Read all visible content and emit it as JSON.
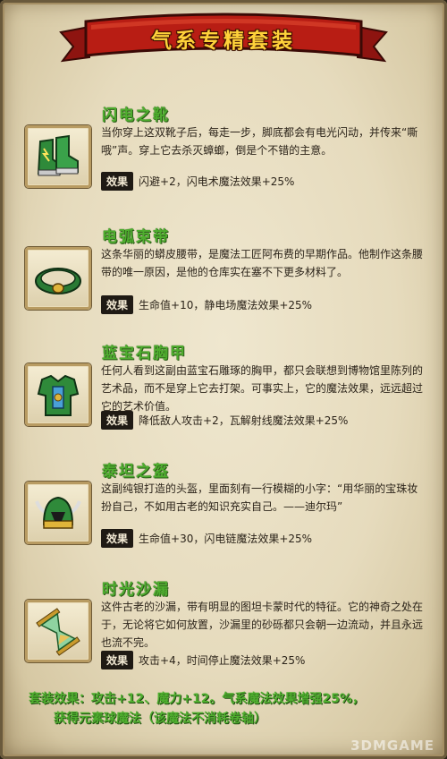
{
  "title": "气系专精套装",
  "effect_label": "效果",
  "items": [
    {
      "name": "闪电之靴",
      "desc": "当你穿上这双靴子后，每走一步，脚底都会有电光闪动，并传来“嘶哦”声。穿上它去杀灭蟑螂，倒是个不错的主意。",
      "effect": "闪避+2，闪电术魔法效果+25%",
      "icon": "boots-icon"
    },
    {
      "name": "电弧束带",
      "desc": "这条华丽的蟒皮腰带，是魔法工匠阿布费的早期作品。他制作这条腰带的唯一原因，是他的仓库实在塞不下更多材料了。",
      "effect": "生命值+10，静电场魔法效果+25%",
      "icon": "belt-icon"
    },
    {
      "name": "蓝宝石胸甲",
      "desc": "任何人看到这副由蓝宝石雕琢的胸甲，都只会联想到博物馆里陈列的艺术品，而不是穿上它去打架。可事实上，它的魔法效果，远远超过它的艺术价值。",
      "effect": "降低敌人攻击+2，瓦解射线魔法效果+25%",
      "icon": "armor-icon"
    },
    {
      "name": "泰坦之盔",
      "desc": "这副纯银打造的头盔，里面刻有一行模糊的小字：“用华丽的宝珠妆扮自己，不如用古老的知识充实自己。——迪尔玛”",
      "effect": "生命值+30，闪电链魔法效果+25%",
      "icon": "helmet-icon"
    },
    {
      "name": "时光沙漏",
      "desc": "这件古老的沙漏，带有明显的图坦卡蒙时代的特征。它的神奇之处在于，无论将它如何放置，沙漏里的砂砾都只会朝一边流动，并且永远也流不完。",
      "effect": "攻击+4，时间停止魔法效果+25%",
      "icon": "hourglass-icon"
    }
  ],
  "set_bonus": {
    "line1": "套装效果：攻击+12、魔力+12。气系魔法效果增强25%，",
    "line2": "获得元素球魔法（该魔法不消耗卷轴）"
  },
  "watermark": "3DMGAME"
}
